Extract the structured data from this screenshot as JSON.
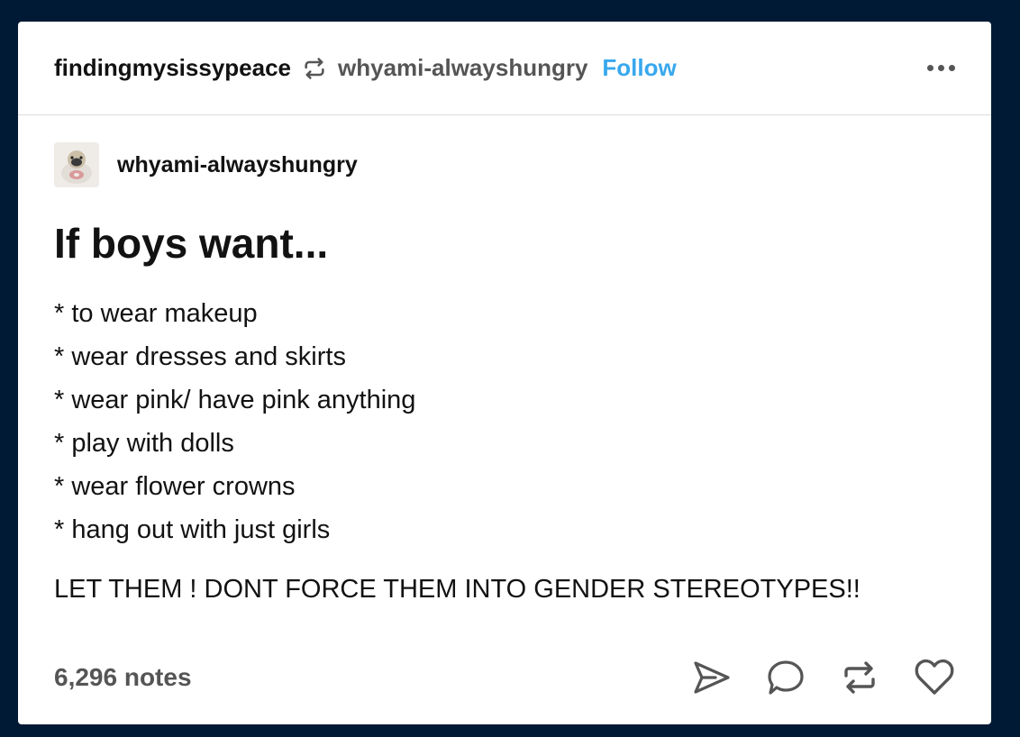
{
  "header": {
    "reblogger": "findingmysissypeace",
    "source": "whyami-alwayshungry",
    "follow_label": "Follow"
  },
  "post": {
    "author": "whyami-alwayshungry",
    "heading": "If boys want...",
    "list_items": [
      "* to wear makeup",
      "* wear dresses and skirts",
      "* wear pink/ have pink anything",
      "* play with dolls",
      "* wear flower crowns",
      "* hang out with just girls"
    ],
    "closing": "LET THEM ! DONT FORCE THEM INTO GENDER STEREOTYPES!!"
  },
  "footer": {
    "notes": "6,296 notes"
  },
  "icons": {
    "reblog": "reblog-icon",
    "more": "more-icon",
    "share": "share-icon",
    "reply": "reply-icon",
    "reblog_action": "reblog-icon",
    "like": "heart-icon"
  },
  "colors": {
    "background": "#001935",
    "accent": "#38a8ee",
    "text": "#121212",
    "secondary": "#555555"
  }
}
